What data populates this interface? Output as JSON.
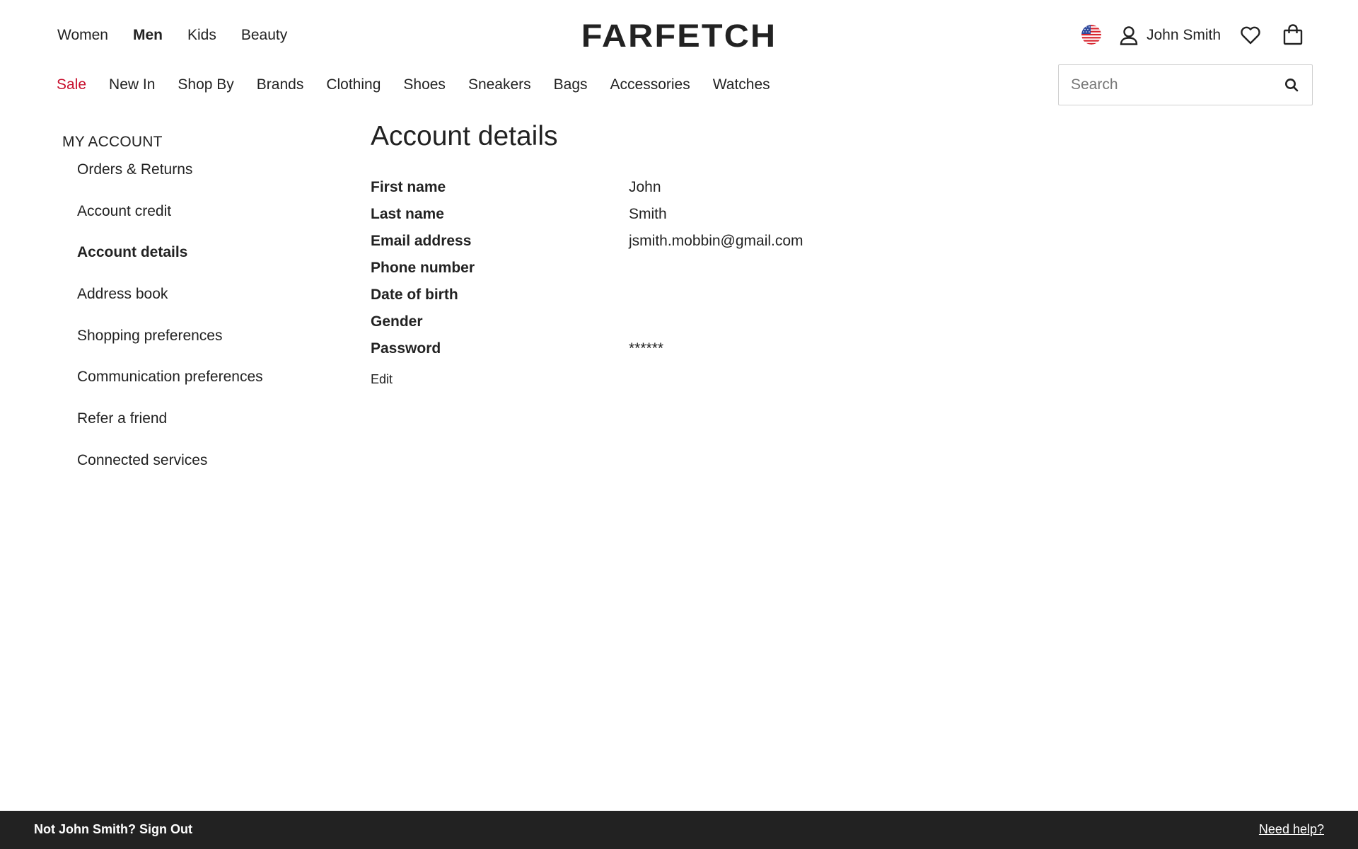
{
  "header": {
    "gender_nav": [
      {
        "label": "Women",
        "active": false
      },
      {
        "label": "Men",
        "active": true
      },
      {
        "label": "Kids",
        "active": false
      },
      {
        "label": "Beauty",
        "active": false
      }
    ],
    "logo": "FARFETCH",
    "user_name": "John Smith",
    "icons": {
      "flag": "us-flag-icon",
      "account": "user-icon",
      "wishlist": "heart-icon",
      "bag": "shopping-bag-icon",
      "search": "search-icon"
    }
  },
  "category_nav": [
    {
      "label": "Sale",
      "highlight": true
    },
    {
      "label": "New In"
    },
    {
      "label": "Shop By"
    },
    {
      "label": "Brands"
    },
    {
      "label": "Clothing"
    },
    {
      "label": "Shoes"
    },
    {
      "label": "Sneakers"
    },
    {
      "label": "Bags"
    },
    {
      "label": "Accessories"
    },
    {
      "label": "Watches"
    }
  ],
  "search": {
    "placeholder": "Search",
    "value": ""
  },
  "sidebar": {
    "title": "MY ACCOUNT",
    "items": [
      {
        "label": "Orders & Returns",
        "active": false
      },
      {
        "label": "Account credit",
        "active": false
      },
      {
        "label": "Account details",
        "active": true
      },
      {
        "label": "Address book",
        "active": false
      },
      {
        "label": "Shopping preferences",
        "active": false
      },
      {
        "label": "Communication preferences",
        "active": false
      },
      {
        "label": "Refer a friend",
        "active": false
      },
      {
        "label": "Connected services",
        "active": false
      }
    ]
  },
  "main": {
    "title": "Account details",
    "fields": [
      {
        "label": "First name",
        "value": "John"
      },
      {
        "label": "Last name",
        "value": "Smith"
      },
      {
        "label": "Email address",
        "value": "jsmith.mobbin@gmail.com"
      },
      {
        "label": "Phone number",
        "value": ""
      },
      {
        "label": "Date of birth",
        "value": ""
      },
      {
        "label": "Gender",
        "value": ""
      },
      {
        "label": "Password",
        "value": "******"
      }
    ],
    "edit_label": "Edit"
  },
  "footer": {
    "signout_text": "Not John Smith? Sign Out",
    "help_text": "Need help?"
  },
  "colors": {
    "text": "#222222",
    "sale": "#c8102e",
    "footer_bg": "#222222",
    "border": "#cfcfcf"
  }
}
